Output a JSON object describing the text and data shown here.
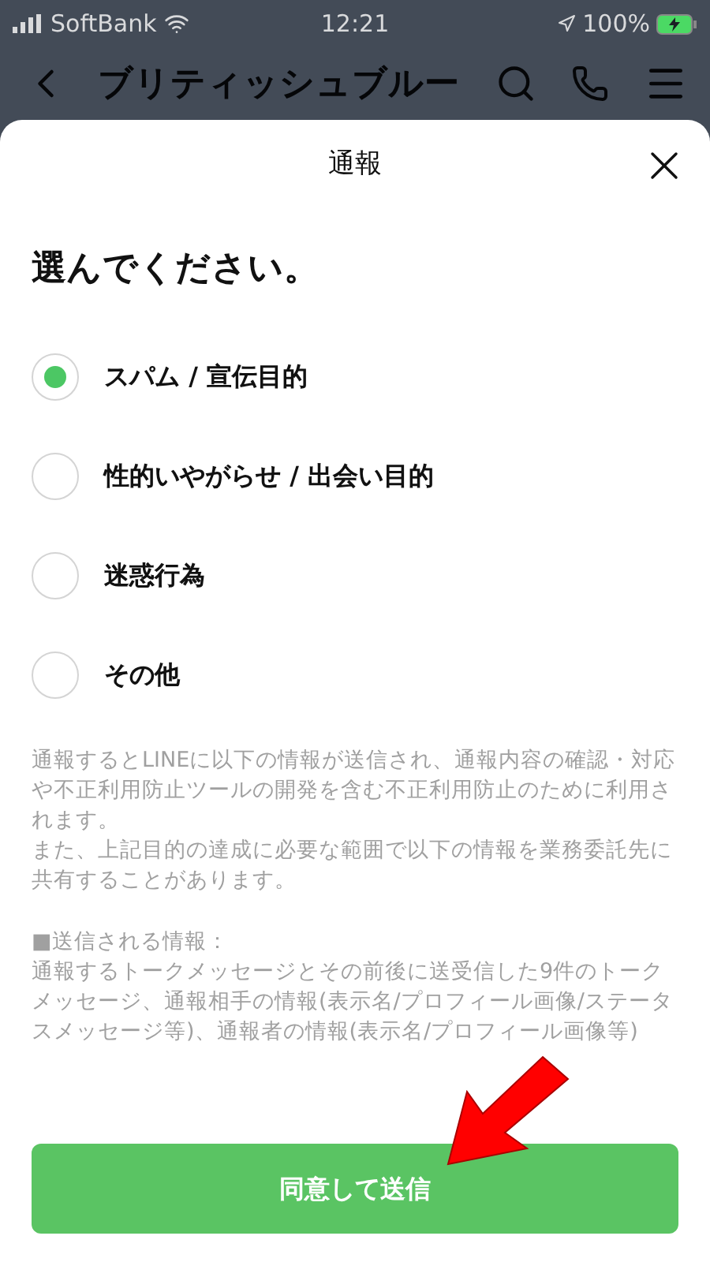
{
  "status_bar": {
    "carrier": "SoftBank",
    "time": "12:21",
    "battery": "100%"
  },
  "nav": {
    "title": "ブリティッシュブルー"
  },
  "sheet": {
    "title": "通報",
    "heading": "選んでください。",
    "options": [
      {
        "label": "スパム / 宣伝目的",
        "selected": true
      },
      {
        "label": "性的いやがらせ / 出会い目的",
        "selected": false
      },
      {
        "label": "迷惑行為",
        "selected": false
      },
      {
        "label": "その他",
        "selected": false
      }
    ],
    "notes": [
      [
        "通報するとLINEに以下の情報が送信され、通報内容の確認・対応や不正利用防止ツールの開発を含む不正利用防止のために利用されます。",
        "また、上記目的の達成に必要な範囲で以下の情報を業務委託先に共有することがあります。"
      ],
      [
        "■送信される情報：",
        "通報するトークメッセージとその前後に送受信した9件のトークメッセージ、通報相手の情報(表示名/プロフィール画像/ステータスメッセージ等)、通報者の情報(表示名/プロフィール画像等)"
      ]
    ],
    "submit": "同意して送信"
  }
}
